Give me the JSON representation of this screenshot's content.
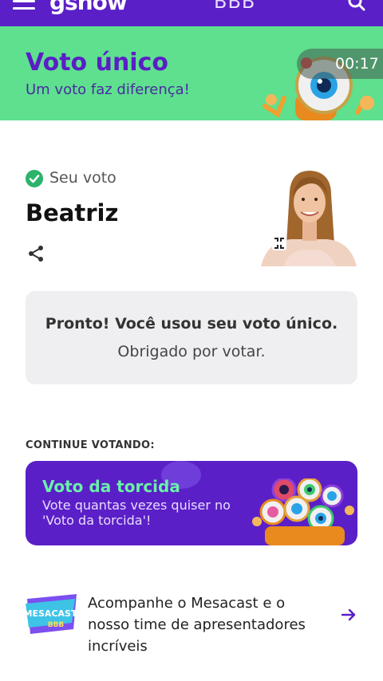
{
  "header": {
    "brand": "gshow",
    "section": "BBB",
    "menu_icon": "hamburger-menu-icon",
    "search_icon": "search-icon",
    "color": "#5b1fc7"
  },
  "banner": {
    "title": "Voto único",
    "subtitle": "Um voto faz diferença!",
    "timer": "00:17",
    "color": "#5ee08f"
  },
  "vote": {
    "label": "Seu voto",
    "name": "Beatriz",
    "check_icon": "check-circle-icon",
    "share_icon": "share-icon",
    "expand_icon": "expand-icon"
  },
  "confirmation": {
    "title": "Pronto! Você usou seu voto único.",
    "subtitle": "Obrigado por votar."
  },
  "continue_voting": {
    "label": "CONTINUE VOTANDO:",
    "card_title": "Voto da torcida",
    "card_subtitle": "Vote quantas vezes quiser no 'Voto da torcida'!",
    "card_color": "#5b1fc7",
    "title_color": "#6af0a8"
  },
  "mesacast": {
    "logo_text": "MESACAST",
    "logo_sub": "BBB",
    "text": "Acompanhe o Mesacast e o nosso time de apresentadores incríveis",
    "arrow_icon": "arrow-right-icon"
  }
}
